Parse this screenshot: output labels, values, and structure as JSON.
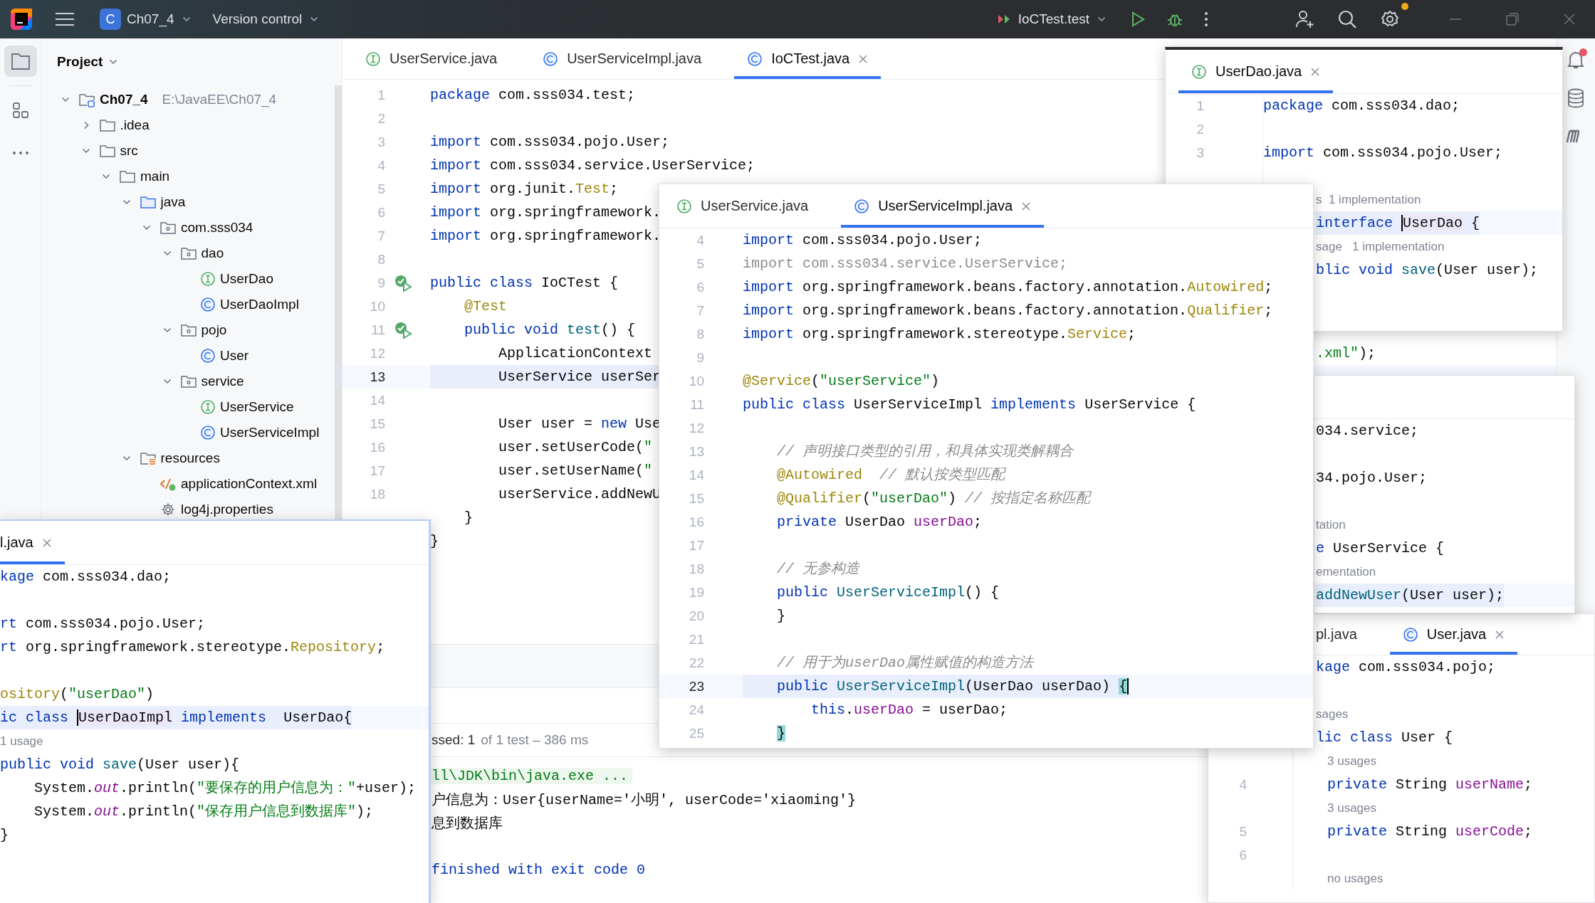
{
  "titlebar": {
    "project_badge": "C",
    "project": "Ch07_4",
    "vcs": "Version control",
    "run_config": "IoCTest.test",
    "settings_badge": true
  },
  "tool_strip": [
    {
      "kind": "project",
      "selected": true
    },
    {
      "kind": "structure",
      "selected": false
    },
    {
      "kind": "more",
      "selected": false
    }
  ],
  "project": {
    "title": "Project",
    "tree": [
      {
        "label": "Ch07_4",
        "kind": "module",
        "path": "E:\\JavaEE\\Ch07_4",
        "expanded": true,
        "children": [
          {
            "label": ".idea",
            "kind": "folder",
            "expanded": false
          },
          {
            "label": "src",
            "kind": "folder",
            "expanded": true,
            "children": [
              {
                "label": "main",
                "kind": "folder",
                "expanded": true,
                "children": [
                  {
                    "label": "java",
                    "kind": "source_root",
                    "expanded": true,
                    "children": [
                      {
                        "label": "com.sss034",
                        "kind": "package",
                        "expanded": true,
                        "children": [
                          {
                            "label": "dao",
                            "kind": "package",
                            "expanded": true,
                            "children": [
                              {
                                "label": "UserDao",
                                "kind": "interface"
                              },
                              {
                                "label": "UserDaoImpl",
                                "kind": "class"
                              }
                            ]
                          },
                          {
                            "label": "pojo",
                            "kind": "package",
                            "expanded": true,
                            "children": [
                              {
                                "label": "User",
                                "kind": "class"
                              }
                            ]
                          },
                          {
                            "label": "service",
                            "kind": "package",
                            "expanded": true,
                            "children": [
                              {
                                "label": "UserService",
                                "kind": "interface"
                              },
                              {
                                "label": "UserServiceImpl",
                                "kind": "class"
                              }
                            ]
                          }
                        ]
                      }
                    ]
                  },
                  {
                    "label": "resources",
                    "kind": "resources",
                    "expanded": true,
                    "children": [
                      {
                        "label": "applicationContext.xml",
                        "kind": "xml"
                      },
                      {
                        "label": "log4j.properties",
                        "kind": "properties"
                      }
                    ]
                  }
                ]
              }
            ]
          }
        ]
      }
    ]
  },
  "main_editor": {
    "tabs": [
      {
        "label": "UserService.java",
        "kind": "interface",
        "selected": false
      },
      {
        "label": "UserServiceImpl.java",
        "kind": "class",
        "selected": false
      },
      {
        "label": "IoCTest.java",
        "kind": "class",
        "selected": true
      }
    ],
    "lines": [
      {
        "kind": "code",
        "num": "1",
        "current": false,
        "tokens": [
          {
            "text": "package",
            "kind": "keyword"
          },
          {
            "text": " com.sss034.test;",
            "kind": "plain"
          }
        ]
      },
      {
        "kind": "blank",
        "num": "2"
      },
      {
        "kind": "code",
        "num": "3",
        "current": false,
        "tokens": [
          {
            "text": "import",
            "kind": "keyword"
          },
          {
            "text": " com.sss034.pojo.User;",
            "kind": "plain"
          }
        ]
      },
      {
        "kind": "code",
        "num": "4",
        "current": false,
        "tokens": [
          {
            "text": "import",
            "kind": "keyword"
          },
          {
            "text": " com.sss034.service.UserService;",
            "kind": "plain"
          }
        ]
      },
      {
        "kind": "code",
        "num": "5",
        "current": false,
        "tokens": [
          {
            "text": "import",
            "kind": "keyword"
          },
          {
            "text": " org.junit.",
            "kind": "plain"
          },
          {
            "text": "Test",
            "kind": "annotation"
          },
          {
            "text": ";",
            "kind": "plain"
          }
        ]
      },
      {
        "kind": "code",
        "num": "6",
        "current": false,
        "tokens": [
          {
            "text": "import",
            "kind": "keyword"
          },
          {
            "text": " org.springframework.",
            "kind": "plain"
          }
        ]
      },
      {
        "kind": "code",
        "num": "7",
        "current": false,
        "tokens": [
          {
            "text": "import",
            "kind": "keyword"
          },
          {
            "text": " org.springframework.",
            "kind": "plain"
          }
        ]
      },
      {
        "kind": "blank",
        "num": "8"
      },
      {
        "kind": "code",
        "num": "9",
        "run_marker": true,
        "current": false,
        "tokens": [
          {
            "text": "public class",
            "kind": "keyword"
          },
          {
            "text": " IoCTest {",
            "kind": "plain"
          }
        ]
      },
      {
        "kind": "code",
        "num": "10",
        "current": false,
        "tokens": [
          {
            "text": "    @Test",
            "kind": "annotation"
          }
        ]
      },
      {
        "kind": "code",
        "num": "11",
        "run_marker": true,
        "current": false,
        "tokens": [
          {
            "text": "    public void",
            "kind": "keyword"
          },
          {
            "text": " test",
            "kind": "method"
          },
          {
            "text": "() {",
            "kind": "plain"
          }
        ]
      },
      {
        "kind": "code",
        "num": "12",
        "current": false,
        "tokens": [
          {
            "text": "        ApplicationContext",
            "kind": "plain"
          }
        ],
        "tail": [
          {
            "text": ".xml\"",
            "kind": "string"
          },
          {
            "text": ");",
            "kind": "plain"
          }
        ]
      },
      {
        "kind": "code",
        "num": "13",
        "current": true,
        "tokens": [
          {
            "text": "        UserService userSer",
            "kind": "plain"
          }
        ]
      },
      {
        "kind": "blank",
        "num": "14"
      },
      {
        "kind": "code",
        "num": "15",
        "current": false,
        "tokens": [
          {
            "text": "        User user = ",
            "kind": "plain"
          },
          {
            "text": "new",
            "kind": "keyword"
          },
          {
            "text": " Use",
            "kind": "plain"
          }
        ]
      },
      {
        "kind": "code",
        "num": "16",
        "current": false,
        "tokens": [
          {
            "text": "        user.setUserCode(",
            "kind": "plain"
          },
          {
            "text": "\"",
            "kind": "string"
          }
        ]
      },
      {
        "kind": "code",
        "num": "17",
        "current": false,
        "tokens": [
          {
            "text": "        user.setUserName(",
            "kind": "plain"
          },
          {
            "text": "\"",
            "kind": "string"
          }
        ]
      },
      {
        "kind": "code",
        "num": "18",
        "current": false,
        "tokens": [
          {
            "text": "        userService.addNewU",
            "kind": "plain"
          }
        ]
      },
      {
        "kind": "code",
        "current": false,
        "tokens": [
          {
            "text": "    }",
            "kind": "plain"
          }
        ]
      },
      {
        "kind": "code",
        "current": false,
        "tokens": [
          {
            "text": "}",
            "kind": "plain"
          }
        ]
      }
    ]
  },
  "run_console": {
    "status": "ssed: 1",
    "detail": "of 1 test – 386 ms",
    "lines": [
      {
        "kind": "command",
        "text": "ll\\JDK\\bin\\java.exe ..."
      },
      {
        "kind": "output",
        "text": "户信息为：User{userName='小明', userCode='xiaoming'}"
      },
      {
        "kind": "output",
        "text": "息到数据库"
      },
      {
        "kind": "exit",
        "text": "finished with exit code 0"
      }
    ]
  },
  "windows": [
    {
      "tabs": [
        {
          "label": "UserDao.java",
          "kind": "interface",
          "selected": true
        }
      ],
      "lines": [
        {
          "kind": "code",
          "num": "1",
          "current": false,
          "tokens": [
            {
              "text": "package",
              "kind": "keyword"
            },
            {
              "text": " com.sss034.dao;",
              "kind": "plain"
            }
          ]
        },
        {
          "kind": "blank",
          "num": "2"
        },
        {
          "kind": "code",
          "num": "3",
          "current": false,
          "tokens": [
            {
              "text": "import",
              "kind": "keyword"
            },
            {
              "text": " com.sss034.pojo.User;",
              "kind": "plain"
            }
          ]
        },
        {
          "kind": "blank"
        },
        {
          "kind": "hint",
          "cut": true,
          "text": "s  1 implementation"
        },
        {
          "kind": "code",
          "cut": true,
          "current": true,
          "tokens": [
            {
              "text": "interface ",
              "kind": "keyword"
            },
            {
              "text": "UserDao",
              "kind": "caret_word"
            },
            {
              "text": " {",
              "kind": "plain"
            }
          ]
        },
        {
          "kind": "hint",
          "cut": true,
          "text": "sage   1 implementation"
        },
        {
          "kind": "code",
          "cut": true,
          "current": false,
          "tokens": [
            {
              "text": "blic void",
              "kind": "keyword"
            },
            {
              "text": " save",
              "kind": "method"
            },
            {
              "text": "(User user);",
              "kind": "plain"
            }
          ]
        }
      ]
    },
    {
      "tabs": [
        {
          "label": "UserService.java",
          "kind": "interface",
          "selected": false
        },
        {
          "label": "UserServiceImpl.java",
          "kind": "class",
          "selected": true
        }
      ],
      "lines": [
        {
          "kind": "code",
          "num": "4",
          "current": false,
          "tokens": [
            {
              "text": "import",
              "kind": "keyword"
            },
            {
              "text": " com.sss034.pojo.User;",
              "kind": "plain"
            }
          ]
        },
        {
          "kind": "code",
          "num": "5",
          "current": false,
          "tokens": [
            {
              "text": "import com.sss034.service.UserService;",
              "kind": "unused"
            }
          ]
        },
        {
          "kind": "code",
          "num": "6",
          "current": false,
          "tokens": [
            {
              "text": "import",
              "kind": "keyword"
            },
            {
              "text": " org.springframework.beans.factory.annotation.",
              "kind": "plain"
            },
            {
              "text": "Autowired",
              "kind": "annotation"
            },
            {
              "text": ";",
              "kind": "plain"
            }
          ]
        },
        {
          "kind": "code",
          "num": "7",
          "current": false,
          "tokens": [
            {
              "text": "import",
              "kind": "keyword"
            },
            {
              "text": " org.springframework.beans.factory.annotation.",
              "kind": "plain"
            },
            {
              "text": "Qualifier",
              "kind": "annotation"
            },
            {
              "text": ";",
              "kind": "plain"
            }
          ]
        },
        {
          "kind": "code",
          "num": "8",
          "current": false,
          "tokens": [
            {
              "text": "import",
              "kind": "keyword"
            },
            {
              "text": " org.springframework.stereotype.",
              "kind": "plain"
            },
            {
              "text": "Service",
              "kind": "annotation"
            },
            {
              "text": ";",
              "kind": "plain"
            }
          ]
        },
        {
          "kind": "blank",
          "num": "9"
        },
        {
          "kind": "code",
          "num": "10",
          "current": false,
          "tokens": [
            {
              "text": "@Service",
              "kind": "annotation"
            },
            {
              "text": "(",
              "kind": "plain"
            },
            {
              "text": "\"userService\"",
              "kind": "string"
            },
            {
              "text": ")",
              "kind": "plain"
            }
          ]
        },
        {
          "kind": "code",
          "num": "11",
          "current": false,
          "tokens": [
            {
              "text": "public class",
              "kind": "keyword"
            },
            {
              "text": " UserServiceImpl ",
              "kind": "plain"
            },
            {
              "text": "implements",
              "kind": "keyword"
            },
            {
              "text": " UserService {",
              "kind": "plain"
            }
          ]
        },
        {
          "kind": "blank",
          "num": "12"
        },
        {
          "kind": "code",
          "num": "13",
          "current": false,
          "tokens": [
            {
              "text": "    // 声明接口类型的引用，和具体实现类解耦合",
              "kind": "comment"
            }
          ]
        },
        {
          "kind": "code",
          "num": "14",
          "current": false,
          "tokens": [
            {
              "text": "    @Autowired",
              "kind": "annotation"
            },
            {
              "text": "  // 默认按类型匹配",
              "kind": "comment"
            }
          ]
        },
        {
          "kind": "code",
          "num": "15",
          "current": false,
          "tokens": [
            {
              "text": "    @Qualifier",
              "kind": "annotation"
            },
            {
              "text": "(",
              "kind": "plain"
            },
            {
              "text": "\"userDao\"",
              "kind": "string"
            },
            {
              "text": ") ",
              "kind": "plain"
            },
            {
              "text": "// 按指定名称匹配",
              "kind": "comment"
            }
          ]
        },
        {
          "kind": "code",
          "num": "16",
          "current": false,
          "tokens": [
            {
              "text": "    private",
              "kind": "keyword"
            },
            {
              "text": " UserDao ",
              "kind": "plain"
            },
            {
              "text": "userDao",
              "kind": "field"
            },
            {
              "text": ";",
              "kind": "plain"
            }
          ]
        },
        {
          "kind": "blank",
          "num": "17"
        },
        {
          "kind": "code",
          "num": "18",
          "current": false,
          "tokens": [
            {
              "text": "    // 无参构造",
              "kind": "comment"
            }
          ]
        },
        {
          "kind": "code",
          "num": "19",
          "current": false,
          "tokens": [
            {
              "text": "    public",
              "kind": "keyword"
            },
            {
              "text": " UserServiceImpl",
              "kind": "method"
            },
            {
              "text": "() {",
              "kind": "plain"
            }
          ]
        },
        {
          "kind": "code",
          "num": "20",
          "current": false,
          "tokens": [
            {
              "text": "    }",
              "kind": "plain"
            }
          ]
        },
        {
          "kind": "blank",
          "num": "21"
        },
        {
          "kind": "code",
          "num": "22",
          "current": false,
          "tokens": [
            {
              "text": "    // 用于为userDao属性赋值的构造方法",
              "kind": "comment"
            }
          ]
        },
        {
          "kind": "code",
          "num": "23",
          "current": true,
          "tokens": [
            {
              "text": "    public",
              "kind": "keyword"
            },
            {
              "text": " UserServiceImpl",
              "kind": "method"
            },
            {
              "text": "(UserDao userDao) ",
              "kind": "plain"
            },
            {
              "text": "{",
              "kind": "brace_caret"
            }
          ]
        },
        {
          "kind": "code",
          "num": "24",
          "current": false,
          "tokens": [
            {
              "text": "        this",
              "kind": "keyword"
            },
            {
              "text": ".",
              "kind": "plain"
            },
            {
              "text": "userDao",
              "kind": "field"
            },
            {
              "text": " = userDao;",
              "kind": "plain"
            }
          ]
        },
        {
          "kind": "code",
          "num": "25",
          "current": false,
          "tokens": [
            {
              "text": "    }",
              "kind": "brace_match"
            }
          ]
        }
      ]
    },
    {
      "lines": [
        {
          "kind": "code",
          "cut": true,
          "current": false,
          "tokens": [
            {
              "text": "034.service;",
              "kind": "plain"
            }
          ]
        },
        {
          "kind": "blank"
        },
        {
          "kind": "code",
          "cut": true,
          "current": false,
          "tokens": [
            {
              "text": "34.pojo.User;",
              "kind": "plain"
            }
          ]
        },
        {
          "kind": "blank"
        },
        {
          "kind": "hint",
          "cut": true,
          "text": "tation"
        },
        {
          "kind": "code",
          "cut": true,
          "current": false,
          "tokens": [
            {
              "text": "e",
              "kind": "keyword"
            },
            {
              "text": " UserService {",
              "kind": "plain"
            }
          ]
        },
        {
          "kind": "hint",
          "cut": true,
          "text": "ementation"
        },
        {
          "kind": "code",
          "cut": true,
          "current": true,
          "tokens": [
            {
              "text": "addNewUser",
              "kind": "method"
            },
            {
              "text": "(User user);",
              "kind": "plain"
            }
          ]
        }
      ]
    },
    {
      "tabs": [
        {
          "label": "l.java",
          "selected": true
        }
      ],
      "lines": [
        {
          "kind": "code",
          "current": false,
          "tokens": [
            {
              "text": "kage",
              "kind": "keyword"
            },
            {
              "text": " com.sss034.dao;",
              "kind": "plain"
            }
          ]
        },
        {
          "kind": "blank"
        },
        {
          "kind": "code",
          "current": false,
          "tokens": [
            {
              "text": "rt",
              "kind": "keyword"
            },
            {
              "text": " com.sss034.pojo.User;",
              "kind": "plain"
            }
          ]
        },
        {
          "kind": "code",
          "current": false,
          "tokens": [
            {
              "text": "rt",
              "kind": "keyword"
            },
            {
              "text": " org.springframework.stereotype.",
              "kind": "plain"
            },
            {
              "text": "Repository",
              "kind": "annotation"
            },
            {
              "text": ";",
              "kind": "plain"
            }
          ]
        },
        {
          "kind": "blank"
        },
        {
          "kind": "code",
          "current": false,
          "tokens": [
            {
              "text": "ository",
              "kind": "annotation"
            },
            {
              "text": "(",
              "kind": "plain"
            },
            {
              "text": "\"userDao\"",
              "kind": "string"
            },
            {
              "text": ")",
              "kind": "plain"
            }
          ]
        },
        {
          "kind": "code",
          "current": true,
          "tokens": [
            {
              "text": "ic class ",
              "kind": "keyword"
            },
            {
              "text": "UserDaoImpl",
              "kind": "caret_word"
            },
            {
              "text": " implements",
              "kind": "keyword"
            },
            {
              "text": "  UserDao{",
              "kind": "plain"
            }
          ]
        },
        {
          "kind": "hint",
          "text": "1 usage"
        },
        {
          "kind": "code",
          "current": false,
          "tokens": [
            {
              "text": "public void",
              "kind": "keyword"
            },
            {
              "text": " save",
              "kind": "method"
            },
            {
              "text": "(User user){",
              "kind": "plain"
            }
          ]
        },
        {
          "kind": "code",
          "current": false,
          "tokens": [
            {
              "text": "    System.",
              "kind": "plain"
            },
            {
              "text": "out",
              "kind": "static"
            },
            {
              "text": ".println(",
              "kind": "plain"
            },
            {
              "text": "\"要保存的用户信息为：\"",
              "kind": "string"
            },
            {
              "text": "+user);",
              "kind": "plain"
            }
          ]
        },
        {
          "kind": "code",
          "current": false,
          "tokens": [
            {
              "text": "    System.",
              "kind": "plain"
            },
            {
              "text": "out",
              "kind": "static"
            },
            {
              "text": ".println(",
              "kind": "plain"
            },
            {
              "text": "\"保存用户信息到数据库\"",
              "kind": "string"
            },
            {
              "text": ");",
              "kind": "plain"
            }
          ]
        },
        {
          "kind": "code",
          "current": false,
          "tokens": [
            {
              "text": "}",
              "kind": "plain"
            }
          ]
        }
      ]
    },
    {
      "tabs": [
        {
          "label": "pl.java",
          "selected": false
        },
        {
          "label": "User.java",
          "kind": "class",
          "selected": true
        }
      ],
      "lines": [
        {
          "kind": "code",
          "cut": true,
          "current": false,
          "tokens": [
            {
              "text": "kage",
              "kind": "keyword"
            },
            {
              "text": " com.sss034.pojo;",
              "kind": "plain"
            }
          ]
        },
        {
          "kind": "blank"
        },
        {
          "kind": "hint",
          "cut": true,
          "text": "sages"
        },
        {
          "kind": "code",
          "cut": true,
          "current": false,
          "tokens": [
            {
              "text": "lic class",
              "kind": "keyword"
            },
            {
              "text": " User {",
              "kind": "plain"
            }
          ]
        },
        {
          "kind": "hint",
          "text": "    3 usages"
        },
        {
          "kind": "code",
          "num": "4",
          "current": false,
          "tokens": [
            {
              "text": "    private",
              "kind": "keyword"
            },
            {
              "text": " String ",
              "kind": "plain"
            },
            {
              "text": "userName",
              "kind": "field"
            },
            {
              "text": ";",
              "kind": "plain"
            }
          ]
        },
        {
          "kind": "hint",
          "text": "    3 usages"
        },
        {
          "kind": "code",
          "num": "5",
          "current": false,
          "tokens": [
            {
              "text": "    private",
              "kind": "keyword"
            },
            {
              "text": " String ",
              "kind": "plain"
            },
            {
              "text": "userCode",
              "kind": "field"
            },
            {
              "text": ";",
              "kind": "plain"
            }
          ]
        },
        {
          "kind": "blank",
          "num": "6"
        },
        {
          "kind": "hint",
          "text": "    no usages"
        }
      ]
    }
  ],
  "right_strip": [
    {
      "kind": "notifications",
      "badge": true
    },
    {
      "kind": "database"
    },
    {
      "kind": "maven"
    }
  ]
}
